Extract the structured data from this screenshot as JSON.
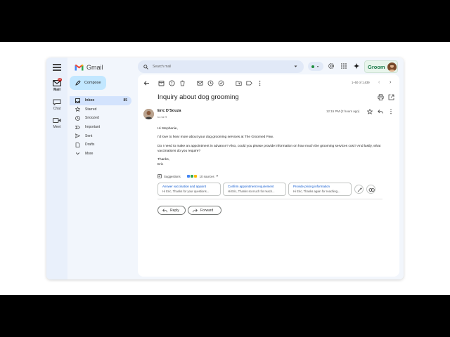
{
  "app": {
    "name": "Gmail"
  },
  "rail": {
    "mail_label": "Mail",
    "mail_badge": "99",
    "chat_label": "Chat",
    "meet_label": "Meet"
  },
  "compose_label": "Compose",
  "nav": [
    {
      "label": "Inbox",
      "count": "85",
      "icon": "inbox-icon"
    },
    {
      "label": "Starred",
      "icon": "star-icon"
    },
    {
      "label": "Snoozed",
      "icon": "clock-icon"
    },
    {
      "label": "Important",
      "icon": "important-icon"
    },
    {
      "label": "Sent",
      "icon": "send-icon"
    },
    {
      "label": "Drafts",
      "icon": "draft-icon"
    },
    {
      "label": "More",
      "icon": "chevron-down-icon"
    }
  ],
  "search": {
    "placeholder": "Search mail"
  },
  "account": {
    "brand_text": "Groom"
  },
  "pager": {
    "text": "1–50 of 1,639"
  },
  "email": {
    "subject": "Inquiry about dog grooming",
    "sender": "Eric D'Souza",
    "to": "to me",
    "time": "12:15 PM (2 hours ago)",
    "greeting": "Hi Stephanie,",
    "para1": "I'd love to hear more about your dog grooming services at The Groomed Paw.",
    "para2": "Do I need to make an appointment in advance? Also, could you please provide information on how much the grooming services cost? And lastly, what vaccinations do you require?",
    "signoff": "Thanks,",
    "signature": "Eric"
  },
  "suggestions": {
    "label": "Suggestions",
    "sources": "10 sources",
    "chips": [
      {
        "title": "Answer vaccination and appoint",
        "preview": "Hi Eric, Thanks for your questions..."
      },
      {
        "title": "Confirm appointment requirement",
        "preview": "Hi Eric, Thanks so much for reach..."
      },
      {
        "title": "Provide pricing information",
        "preview": "Hi Eric, Thanks again for reaching..."
      }
    ]
  },
  "actions": {
    "reply": "Reply",
    "forward": "Forward"
  },
  "colors": {
    "accent": "#0b57d0",
    "compose_bg": "#c2e7ff",
    "active_nav": "#d3e3fd",
    "window_bg": "#f2f6fc"
  }
}
